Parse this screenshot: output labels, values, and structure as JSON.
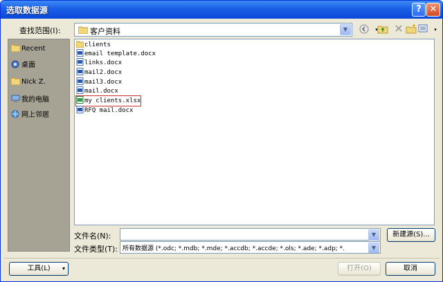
{
  "window": {
    "title": "选取数据源"
  },
  "title_buttons": {
    "help": "?",
    "close": "✕"
  },
  "lookin": {
    "label": "查找范围(I):",
    "value": "客户资料"
  },
  "toolbar": [
    "back-icon",
    "up-folder-icon",
    "delete-icon",
    "new-folder-icon",
    "views-icon"
  ],
  "places": [
    {
      "label": "Recent",
      "icon": "recent-folder-icon"
    },
    {
      "label": "桌面",
      "icon": "desktop-icon"
    },
    {
      "label": "Nick Z.",
      "icon": "user-folder-icon"
    },
    {
      "label": "我的电脑",
      "icon": "my-computer-icon"
    },
    {
      "label": "网上邻居",
      "icon": "network-icon"
    }
  ],
  "files": [
    {
      "name": "clients",
      "icon": "folder-icon"
    },
    {
      "name": "email template.docx",
      "icon": "word-doc-icon"
    },
    {
      "name": "links.docx",
      "icon": "word-doc-icon"
    },
    {
      "name": "mail2.docx",
      "icon": "word-doc-icon"
    },
    {
      "name": "mail3.docx",
      "icon": "word-doc-icon"
    },
    {
      "name": "mail.docx",
      "icon": "word-doc-icon"
    },
    {
      "name": "my clients.xlsx",
      "icon": "excel-doc-icon",
      "selected": true
    },
    {
      "name": "RFQ mail.docx",
      "icon": "word-doc-icon"
    }
  ],
  "file_name": {
    "label": "文件名(N):",
    "value": ""
  },
  "file_type": {
    "label": "文件类型(T):",
    "value": "所有数据源 (*.odc; *.mdb; *.mde; *.accdb; *.accde; *.ols; *.ade; *.adp; *."
  },
  "buttons": {
    "new_source": "新建源(S)...",
    "tools": "工具(L)",
    "open": "打开(O)",
    "cancel": "取消"
  },
  "colors": {
    "title_bar": "#1a5ee6",
    "dialog_bg": "#ece9d8",
    "selection_outline": "#c83232"
  }
}
